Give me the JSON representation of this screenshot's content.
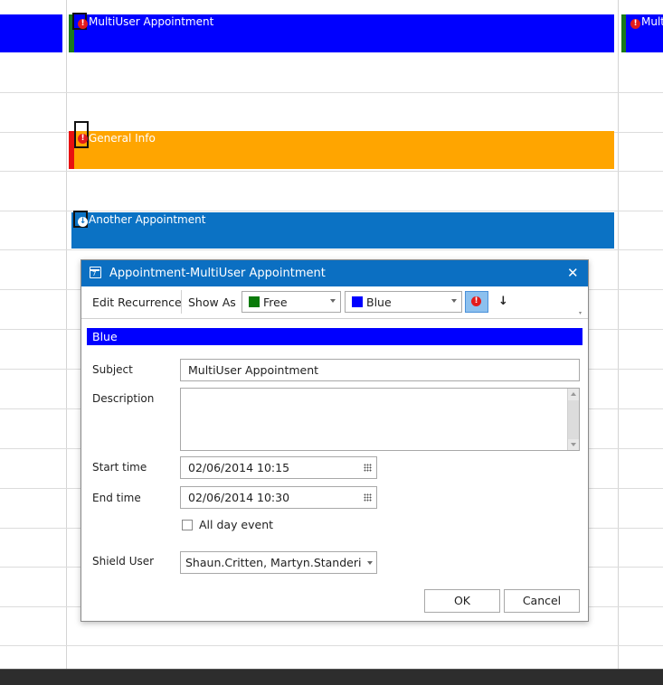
{
  "calendar": {
    "appointments": [
      {
        "title": "MultiUser Appointment",
        "color": "#0000ff",
        "status_color": "#1a7a1a",
        "icon": "alert-icon"
      },
      {
        "title": "General Info",
        "color": "#ffa500",
        "status_color": "#e81010",
        "icon": "alert-icon"
      },
      {
        "title": "Another Appointment",
        "color": "#0b72c4",
        "status_color": "#ffffff",
        "icon": "down-arrow-icon"
      },
      {
        "title": "Mult",
        "color": "#0000ff",
        "status_color": "#1a7a1a",
        "icon": "alert-icon"
      }
    ]
  },
  "dialog": {
    "title": "Appointment-MultiUser Appointment",
    "toolbar": {
      "edit_recurrence": "Edit Recurrence",
      "show_as_label": "Show As",
      "show_as_value": "Free",
      "show_as_color": "#0a7a0a",
      "category_value": "Blue",
      "category_color": "#0000ff"
    },
    "category_bar": "Blue",
    "form": {
      "subject_label": "Subject",
      "subject_value": "MultiUser Appointment",
      "description_label": "Description",
      "description_value": "",
      "start_label": "Start time",
      "start_value": "02/06/2014 10:15",
      "end_label": "End time",
      "end_value": "02/06/2014 10:30",
      "all_day_label": "All day event",
      "shield_label": "Shield User",
      "shield_value": "Shaun.Critten, Martyn.Standeri"
    },
    "buttons": {
      "ok": "OK",
      "cancel": "Cancel"
    }
  }
}
